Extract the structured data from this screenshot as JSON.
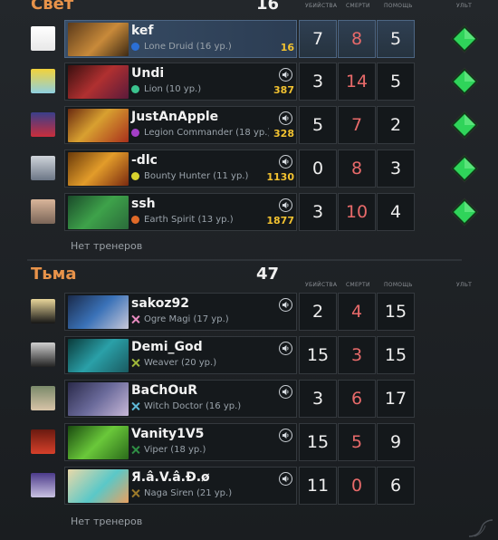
{
  "columns": {
    "kills": "УБИЙСТВА",
    "deaths": "СМЕРТИ",
    "assists": "ПОМОЩЬ",
    "ult": "УЛЬТ"
  },
  "teams": [
    {
      "name": "Свет",
      "score": "16",
      "no_coaches": "Нет тренеров",
      "players": [
        {
          "name": "kef",
          "hero": "Lone Druid (16 ур.)",
          "gold": "16",
          "kills": "7",
          "deaths": "8",
          "assists": "5",
          "dot_color": "#2b6fd6",
          "self": true
        },
        {
          "name": "Undi",
          "hero": "Lion (10 ур.)",
          "gold": "387",
          "kills": "3",
          "deaths": "14",
          "assists": "5",
          "dot_color": "#3bc48f"
        },
        {
          "name": "JustAnApple",
          "hero": "Legion Commander (18 ур.)",
          "gold": "328",
          "kills": "5",
          "deaths": "7",
          "assists": "2",
          "dot_color": "#a43fc8"
        },
        {
          "name": "-dlc",
          "hero": "Bounty Hunter (11 ур.)",
          "gold": "1130",
          "kills": "0",
          "deaths": "8",
          "assists": "3",
          "dot_color": "#d8d22e"
        },
        {
          "name": "ssh",
          "hero": "Earth Spirit (13 ур.)",
          "gold": "1877",
          "kills": "3",
          "deaths": "10",
          "assists": "4",
          "dot_color": "#e06a28"
        }
      ]
    },
    {
      "name": "Тьма",
      "score": "47",
      "no_coaches": "Нет тренеров",
      "players": [
        {
          "name": "sakoz92",
          "hero": "Ogre Magi (17 ур.)",
          "kills": "2",
          "deaths": "4",
          "assists": "15",
          "dot_color": "#e88bc0"
        },
        {
          "name": "Demi_God",
          "hero": "Weaver (20 ур.)",
          "kills": "15",
          "deaths": "3",
          "assists": "15",
          "dot_color": "#9fb83a"
        },
        {
          "name": "BaChOuR",
          "hero": "Witch Doctor (16 ур.)",
          "kills": "3",
          "deaths": "6",
          "assists": "17",
          "dot_color": "#5fb9d8"
        },
        {
          "name": "Vanity1V5",
          "hero": "Viper (18 ур.)",
          "kills": "15",
          "deaths": "5",
          "assists": "9",
          "dot_color": "#2f8f45"
        },
        {
          "name": "Я.â.V.â.Ð.ø",
          "hero": "Naga Siren (21 ур.)",
          "kills": "11",
          "deaths": "0",
          "assists": "6",
          "dot_color": "#9c7a2a"
        }
      ]
    }
  ],
  "colors": {
    "team_name": "#e8934a",
    "gold": "#f2c230",
    "deaths": "#e86a6a",
    "ult_ready": "#2fd45a",
    "self_row": "#384d66"
  }
}
